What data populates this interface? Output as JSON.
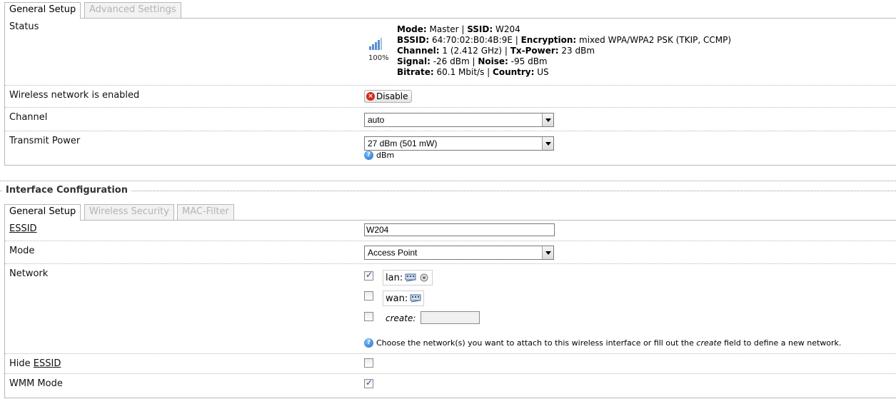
{
  "top_tabs": [
    {
      "label": "General Setup",
      "active": true
    },
    {
      "label": "Advanced Settings",
      "active": false
    }
  ],
  "status": {
    "label": "Status",
    "signal_pct": "100%",
    "lines": {
      "mode_k": "Mode:",
      "mode_v": " Master | ",
      "ssid_k": "SSID:",
      "ssid_v": " W204",
      "bssid_k": "BSSID:",
      "bssid_v": " 64:70:02:B0:4B:9E | ",
      "enc_k": "Encryption:",
      "enc_v": " mixed WPA/WPA2 PSK (TKIP, CCMP)",
      "channel_k": "Channel:",
      "channel_v": " 1 (2.412 GHz) | ",
      "txp_k": "Tx-Power:",
      "txp_v": " 23 dBm",
      "signal_k": "Signal:",
      "signal_v": " -26 dBm | ",
      "noise_k": "Noise:",
      "noise_v": " -95 dBm",
      "bitrate_k": "Bitrate:",
      "bitrate_v": " 60.1 Mbit/s | ",
      "country_k": "Country:",
      "country_v": " US"
    }
  },
  "wireless_enabled": {
    "label": "Wireless network is enabled",
    "button": "Disable"
  },
  "channel": {
    "label": "Channel",
    "value": "auto"
  },
  "transmit_power": {
    "label": "Transmit Power",
    "value": "27 dBm (501 mW)",
    "hint": "dBm"
  },
  "section_title": "Interface Configuration",
  "iface_tabs": [
    {
      "label": "General Setup",
      "active": true
    },
    {
      "label": "Wireless Security",
      "active": false
    },
    {
      "label": "MAC-Filter",
      "active": false
    }
  ],
  "essid": {
    "label": "ESSID",
    "value": "W204"
  },
  "mode": {
    "label": "Mode",
    "value": "Access Point"
  },
  "network": {
    "label": "Network",
    "items": [
      {
        "name": "lan:",
        "checked": true
      },
      {
        "name": "wan:",
        "checked": false
      }
    ],
    "create_label": "create:",
    "create_value": "",
    "help_pre": "Choose the network(s) you want to attach to this wireless interface or fill out the ",
    "help_em": "create",
    "help_post": " field to define a new network."
  },
  "hide_essid": {
    "label_pre": "Hide ",
    "label_u": "ESSID",
    "checked": false
  },
  "wmm_mode": {
    "label": "WMM Mode",
    "checked": true
  },
  "colors": {
    "border": "#b8b8b8",
    "inactive_tab_text": "#b4b4b4",
    "disable_icon": "#d8261c",
    "help_icon": "#1f6fc4"
  }
}
